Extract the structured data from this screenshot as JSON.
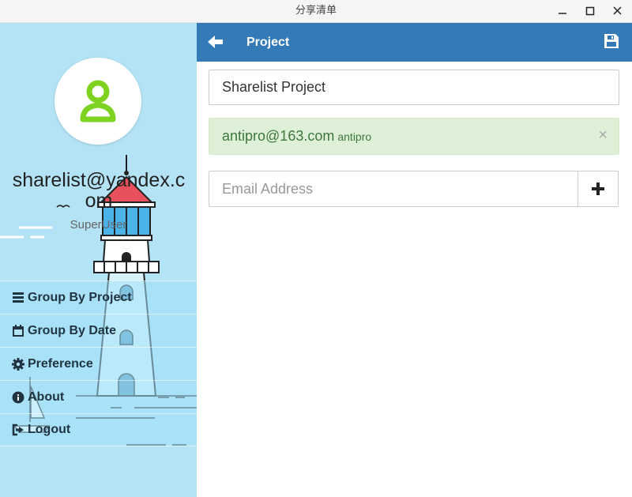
{
  "window": {
    "title": "分享清单"
  },
  "user": {
    "email": "sharelist@yandex.com",
    "role": "SuperUser"
  },
  "sidebar": {
    "items": [
      {
        "label": "Group By Project",
        "icon": "list-icon"
      },
      {
        "label": "Group By Date",
        "icon": "calendar-icon"
      },
      {
        "label": "Preference",
        "icon": "gear-icon"
      },
      {
        "label": "About",
        "icon": "info-icon"
      },
      {
        "label": "Logout",
        "icon": "logout-icon"
      }
    ]
  },
  "header": {
    "title": "Project"
  },
  "project": {
    "name": "Sharelist Project",
    "members": [
      {
        "email": "antipro@163.com",
        "name": "antipro"
      }
    ],
    "email_placeholder": "Email Address"
  },
  "colors": {
    "header": "#337ab7",
    "sidebar": "#b3e3f5",
    "member_bg": "#dff0d8",
    "avatar_icon": "#7ed321"
  }
}
